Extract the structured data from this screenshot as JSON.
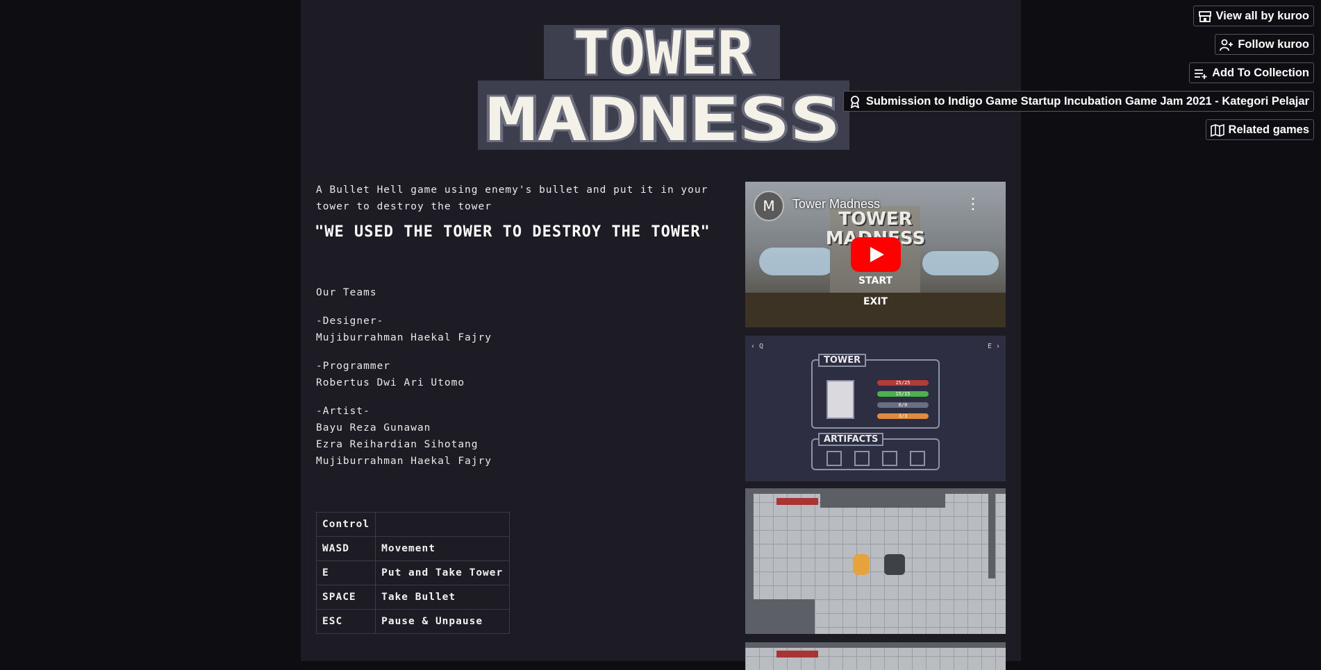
{
  "logo": {
    "line1": "TOWER",
    "line2": "MADNESS"
  },
  "description": {
    "intro": "A Bullet Hell game using enemy's bullet and put it in your tower to destroy the tower",
    "slogan": "\"WE USED THE TOWER TO DESTROY THE TOWER\""
  },
  "team": {
    "heading": "Our Teams",
    "designer_label": "-Designer-",
    "designer_1": "Mujiburrahman Haekal Fajry",
    "programmer_label": "-Programmer",
    "programmer_1": "Robertus Dwi Ari Utomo",
    "artist_label": "-Artist-",
    "artist_1": "Bayu Reza Gunawan",
    "artist_2": "Ezra Reihardian Sihotang",
    "artist_3": "Mujiburrahman Haekal Fajry"
  },
  "controls": {
    "header": "Control",
    "rows": [
      {
        "key": "WASD",
        "action": "Movement"
      },
      {
        "key": "E",
        "action": "Put and Take Tower"
      },
      {
        "key": "SPACE",
        "action": "Take Bullet"
      },
      {
        "key": "ESC",
        "action": "Pause & Unpause"
      }
    ]
  },
  "video": {
    "channel_initial": "M",
    "title": "Tower Madness",
    "game_title_line1": "TOWER",
    "game_title_line2": "MADNESS",
    "menu_start": "START",
    "menu_exit": "EXIT"
  },
  "screenshot_ui": {
    "nav_left": "‹ Q",
    "nav_right": "E ›",
    "tower_label": "TOWER",
    "stat_1": "25/25",
    "stat_2": "15/15",
    "stat_3": "0/0",
    "stat_4": "3/3",
    "artifacts_label": "ARTIFACTS"
  },
  "sidebar": {
    "view_all": "View all by kuroo",
    "follow": "Follow kuroo",
    "add_collection": "Add To Collection",
    "submission": "Submission to Indigo Game Startup Incubation Game Jam 2021 - Kategori Pelajar",
    "related": "Related games"
  },
  "colors": {
    "page_bg": "#1d1c24",
    "outer_bg": "#0e0e12",
    "logo_fill": "#f4f1e8",
    "logo_outline": "#5a5b68",
    "youtube_red": "#ff0000"
  }
}
